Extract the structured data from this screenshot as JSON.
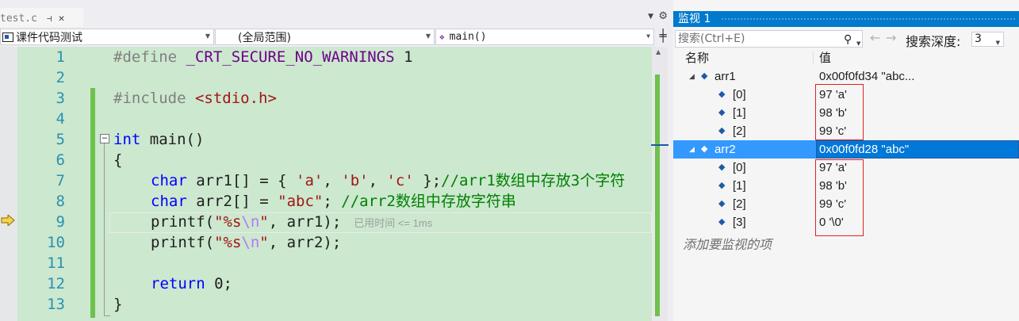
{
  "editor": {
    "tab": {
      "label": "test.c",
      "pin_icon": "pin-icon",
      "close_icon": "close-icon"
    },
    "nav": {
      "project": "课件代码测试",
      "scope": "(全局范围)",
      "function": "main()"
    },
    "lines": [
      {
        "n": "1"
      },
      {
        "n": "2"
      },
      {
        "n": "3"
      },
      {
        "n": "4"
      },
      {
        "n": "5"
      },
      {
        "n": "6"
      },
      {
        "n": "7"
      },
      {
        "n": "8"
      },
      {
        "n": "9"
      },
      {
        "n": "10"
      },
      {
        "n": "11"
      },
      {
        "n": "12"
      },
      {
        "n": "13"
      }
    ],
    "code": {
      "l1_directive": "#define ",
      "l1_macro": "_CRT_SECURE_NO_WARNINGS",
      "l1_value": " 1",
      "l3_directive": "#include ",
      "l3_header": "<stdio.h>",
      "l5_type": "int",
      "l5_rest": " main()",
      "l6": "{",
      "l7_type": "char",
      "l7_decl": " arr1[] = { ",
      "l7_c1": "'a'",
      "l7_sep1": ", ",
      "l7_c2": "'b'",
      "l7_sep2": ", ",
      "l7_c3": "'c'",
      "l7_end": " };",
      "l7_comment": "//arr1数组中存放3个字符",
      "l8_type": "char",
      "l8_decl": " arr2[] = ",
      "l8_str": "\"abc\"",
      "l8_end": "; ",
      "l8_comment": "//arr2数组中存放字符串",
      "l9_fn": "printf(",
      "l9_str_a": "\"%s",
      "l9_esc": "\\n",
      "l9_str_b": "\"",
      "l9_rest": ", arr1);",
      "l9_perf": "已用时间 <= 1ms",
      "l10_fn": "printf(",
      "l10_str_a": "\"%s",
      "l10_esc": "\\n",
      "l10_str_b": "\"",
      "l10_rest": ", arr2);",
      "l12_kw": "return",
      "l12_rest": " 0;",
      "l13": "}"
    }
  },
  "watch": {
    "title": "监视 1",
    "search_placeholder": "搜索(Ctrl+E)",
    "depth_label": "搜索深度:",
    "depth_value": "3",
    "col_name": "名称",
    "col_value": "值",
    "rows": [
      {
        "name": "arr1",
        "value": "0x00f0fd34 \"abc...",
        "level": 0,
        "expanded": true
      },
      {
        "name": "[0]",
        "value": "97 'a'",
        "level": 1
      },
      {
        "name": "[1]",
        "value": "98 'b'",
        "level": 1
      },
      {
        "name": "[2]",
        "value": "99 'c'",
        "level": 1
      },
      {
        "name": "arr2",
        "value": "0x00f0fd28 \"abc\"",
        "level": 0,
        "expanded": true,
        "selected": true
      },
      {
        "name": "[0]",
        "value": "97 'a'",
        "level": 1
      },
      {
        "name": "[1]",
        "value": "98 'b'",
        "level": 1
      },
      {
        "name": "[2]",
        "value": "99 'c'",
        "level": 1
      },
      {
        "name": "[3]",
        "value": "0 '\\0'",
        "level": 1
      }
    ],
    "add_item": "添加要监视的项"
  },
  "colors": {
    "code_bg": "#cce8cf",
    "keyword": "#0000ff",
    "string": "#a31515",
    "comment": "#008000",
    "macro": "#6f008a",
    "title_bar": "#007acc",
    "selection": "#3399ff",
    "highlight_box": "#e02020"
  }
}
